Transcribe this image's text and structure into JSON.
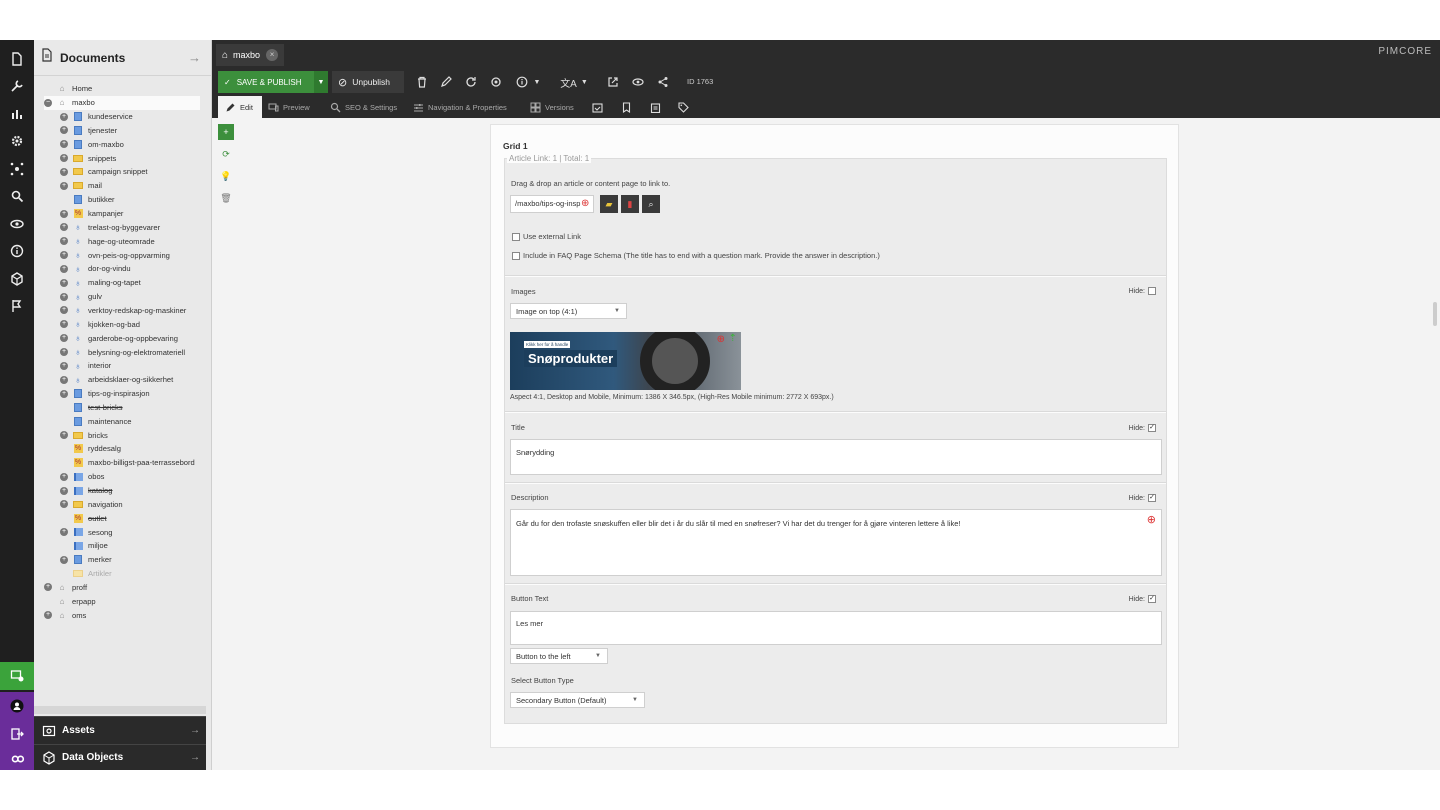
{
  "tree": {
    "title": "Documents",
    "items": [
      {
        "label": "Home"
      },
      {
        "label": "maxbo"
      },
      {
        "label": "kundeservice"
      },
      {
        "label": "tjenester"
      },
      {
        "label": "om-maxbo"
      },
      {
        "label": "snippets"
      },
      {
        "label": "campaign snippet"
      },
      {
        "label": "mail"
      },
      {
        "label": "butikker"
      },
      {
        "label": "kampanjer"
      },
      {
        "label": "trelast-og-byggevarer"
      },
      {
        "label": "hage-og-uteomrade"
      },
      {
        "label": "ovn-peis-og-oppvarming"
      },
      {
        "label": "dor-og-vindu"
      },
      {
        "label": "maling-og-tapet"
      },
      {
        "label": "gulv"
      },
      {
        "label": "verktoy-redskap-og-maskiner"
      },
      {
        "label": "kjokken-og-bad"
      },
      {
        "label": "garderobe-og-oppbevaring"
      },
      {
        "label": "belysning-og-elektromateriell"
      },
      {
        "label": "interior"
      },
      {
        "label": "arbeidsklaer-og-sikkerhet"
      },
      {
        "label": "tips-og-inspirasjon"
      },
      {
        "label": "test-bricks"
      },
      {
        "label": "maintenance"
      },
      {
        "label": "bricks"
      },
      {
        "label": "ryddesalg"
      },
      {
        "label": "maxbo-billigst-paa-terrassebord"
      },
      {
        "label": "obos"
      },
      {
        "label": "katalog"
      },
      {
        "label": "navigation"
      },
      {
        "label": "outlet"
      },
      {
        "label": "sesong"
      },
      {
        "label": "miljoe"
      },
      {
        "label": "merker"
      },
      {
        "label": "Artikler"
      },
      {
        "label": "proff"
      },
      {
        "label": "erpapp"
      },
      {
        "label": "oms"
      }
    ],
    "accordions": {
      "assets": "Assets",
      "data_objects": "Data Objects"
    }
  },
  "tabstrip": {
    "doc_tab": "maxbo",
    "logo": "PIMCORE"
  },
  "toolbar": {
    "save_publish": "SAVE & PUBLISH",
    "unpublish": "Unpublish",
    "id": "ID 1763"
  },
  "subtabs": {
    "edit": "Edit",
    "preview": "Preview",
    "seo": "SEO & Settings",
    "navigation": "Navigation & Properties",
    "versions": "Versions"
  },
  "editor": {
    "grid_title": "Grid 1",
    "legend": "Article Link: 1 | Total: 1",
    "drag_hint": "Drag & drop an article or content page to link to.",
    "link_value": "/maxbo/tips-og-insp",
    "use_external": "Use external Link",
    "faq": "Include in FAQ Page Schema (The title has to end with a question mark. Provide the answer in description.)",
    "images_label": "Images",
    "hide_label": "Hide:",
    "image_layout": "Image on top (4:1)",
    "banner_small": "Klikk her for å handle",
    "banner_text": "Snøprodukter",
    "aspect_hint": "Aspect 4:1, Desktop and Mobile, Minimum: 1386 X 346.5px, (High-Res Mobile minimum: 2772 X 693px.)",
    "title_label": "Title",
    "title_value": "Snørydding",
    "description_label": "Description",
    "description_value": "Går du for den trofaste snøskuffen eller blir det i år du slår til med en snøfreser? Vi har det du trenger for å gjøre vinteren lettere å like!",
    "button_text_label": "Button Text",
    "button_text_value": "Les mer",
    "button_position": "Button to the left",
    "select_button_type_label": "Select Button Type",
    "button_type": "Secondary Button (Default)",
    "hide_images": false,
    "hide_title": true,
    "hide_description": true,
    "hide_button": true
  },
  "colors": {
    "accent_green": "#3c8f3c",
    "rail": "#1f1f1f",
    "chat_green": "#3ba33b",
    "purple": "#6a2d9a"
  }
}
